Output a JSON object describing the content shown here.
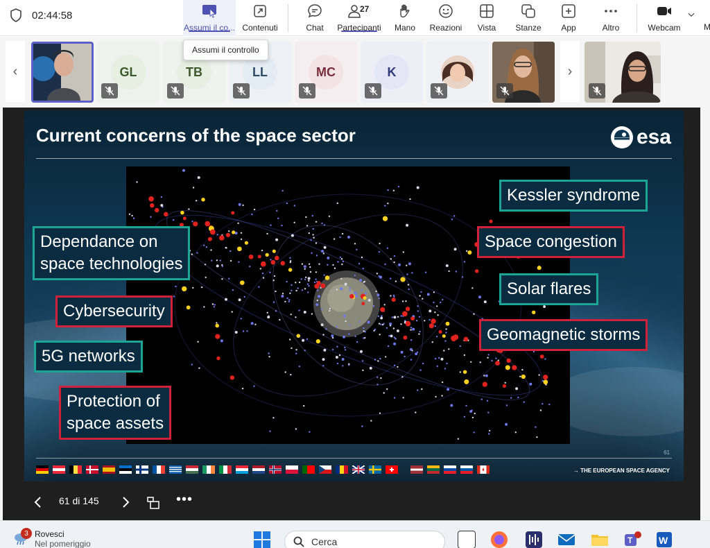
{
  "topbar": {
    "timer": "02:44:58",
    "take_control": "Assumi il co...",
    "content": "Contenuti",
    "chat": "Chat",
    "participants": "Partecipanti",
    "participants_count": "27",
    "raise_hand": "Mano",
    "reactions": "Reazioni",
    "view": "Vista",
    "rooms": "Stanze",
    "apps": "App",
    "more": "Altro",
    "camera": "Webcam",
    "mic_cut": "M",
    "tooltip": "Assumi il controllo"
  },
  "participants": [
    {
      "initials": "GL",
      "bg": "#e6efe2",
      "fg": "#3d5a2e"
    },
    {
      "initials": "TB",
      "bg": "#e6efe2",
      "fg": "#3d5a2e"
    },
    {
      "initials": "LL",
      "bg": "#e3ebf3",
      "fg": "#2e4a66"
    },
    {
      "initials": "MC",
      "bg": "#f4e3e6",
      "fg": "#7a2d3d"
    },
    {
      "initials": "K",
      "bg": "#e4e6f5",
      "fg": "#2f3a7a"
    }
  ],
  "slide": {
    "title": "Current concerns of the space sector",
    "logo_text": "esa",
    "labels": {
      "kessler": "Kessler syndrome",
      "dependance_1": "Dependance on",
      "dependance_2": "space technologies",
      "congestion": "Space congestion",
      "solar": "Solar flares",
      "cyber": "Cybersecurity",
      "geomagnetic": "Geomagnetic storms",
      "fiveg": "5G networks",
      "protection_1": "Protection of",
      "protection_2": "space assets"
    },
    "page_small": "61",
    "agency": "→ THE EUROPEAN SPACE AGENCY"
  },
  "presentation": {
    "counter": "61 di 145"
  },
  "taskbar": {
    "weather_badge": "3",
    "weather_title": "Rovesci",
    "weather_sub": "Nel pomeriggio",
    "search": "Cerca"
  },
  "colors": {
    "accent": "#5b5fc7",
    "teal_border": "#1aa595",
    "red_border": "#d0213a"
  }
}
